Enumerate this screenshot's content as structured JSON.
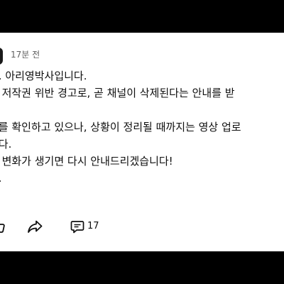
{
  "post": {
    "timestamp": "17분 전",
    "lines": [
      "요. 아리영박사입니다.",
      "에 저작권 위반 경고로, 곧 채널이 삭제된다는 안내를 받",
      "",
      "치를 확인하고 있으나, 상황이 정리될 때까지는 영상 업로",
      "니다.",
      "에 변화가 생기면 다시 안내드리겠습니다!",
      "다."
    ]
  },
  "actions": {
    "like_icon": "thumbs-up-icon",
    "share_icon": "share-icon",
    "comment_icon": "comment-icon",
    "comment_count": "17"
  }
}
